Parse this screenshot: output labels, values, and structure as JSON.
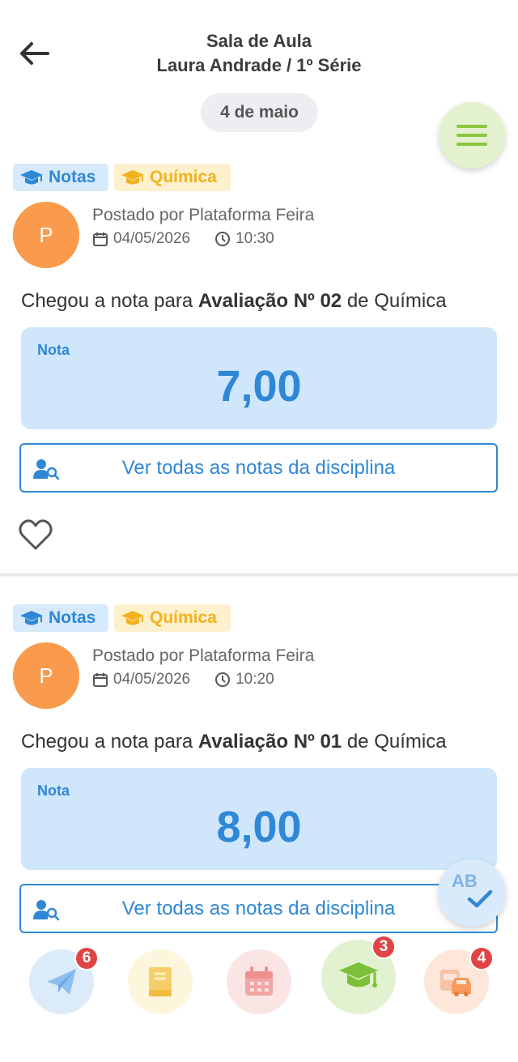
{
  "header": {
    "title": "Sala de Aula",
    "subtitle": "Laura Andrade / 1º Série",
    "back_icon": "arrow-left-icon"
  },
  "date_label": "4 de maio",
  "colors": {
    "accent_blue": "#2f87d6",
    "grade_bg": "#cfe6fb",
    "tag_yellow": "#f0b21f",
    "avatar_orange": "#f99a4c",
    "menu_green": "#8cc63f",
    "badge_red": "#e04545"
  },
  "posts": [
    {
      "tags": [
        "Notas",
        "Química"
      ],
      "avatar_initial": "P",
      "posted_by": "Postado por Plataforma Feira",
      "date": "04/05/2026",
      "time": "10:30",
      "message_prefix": "Chegou a nota para ",
      "message_bold": "Avaliação Nº 02",
      "message_suffix": " de Química",
      "grade_label": "Nota",
      "grade_value": "7,00",
      "see_all_label": "Ver todas as notas da disciplina"
    },
    {
      "tags": [
        "Notas",
        "Química"
      ],
      "avatar_initial": "P",
      "posted_by": "Postado por Plataforma Feira",
      "date": "04/05/2026",
      "time": "10:20",
      "message_prefix": "Chegou a nota para ",
      "message_bold": "Avaliação Nº 01",
      "message_suffix": " de Química",
      "grade_label": "Nota",
      "grade_value": "8,00",
      "see_all_label": "Ver todas as notas da disciplina"
    }
  ],
  "ab_fab_label": "AB",
  "bottom_nav": [
    {
      "icon": "paper-plane-icon",
      "badge": "6"
    },
    {
      "icon": "book-icon",
      "badge": ""
    },
    {
      "icon": "calendar-icon",
      "badge": ""
    },
    {
      "icon": "graduation-cap-icon",
      "badge": "3",
      "active": true
    },
    {
      "icon": "bus-car-icon",
      "badge": "4"
    }
  ]
}
